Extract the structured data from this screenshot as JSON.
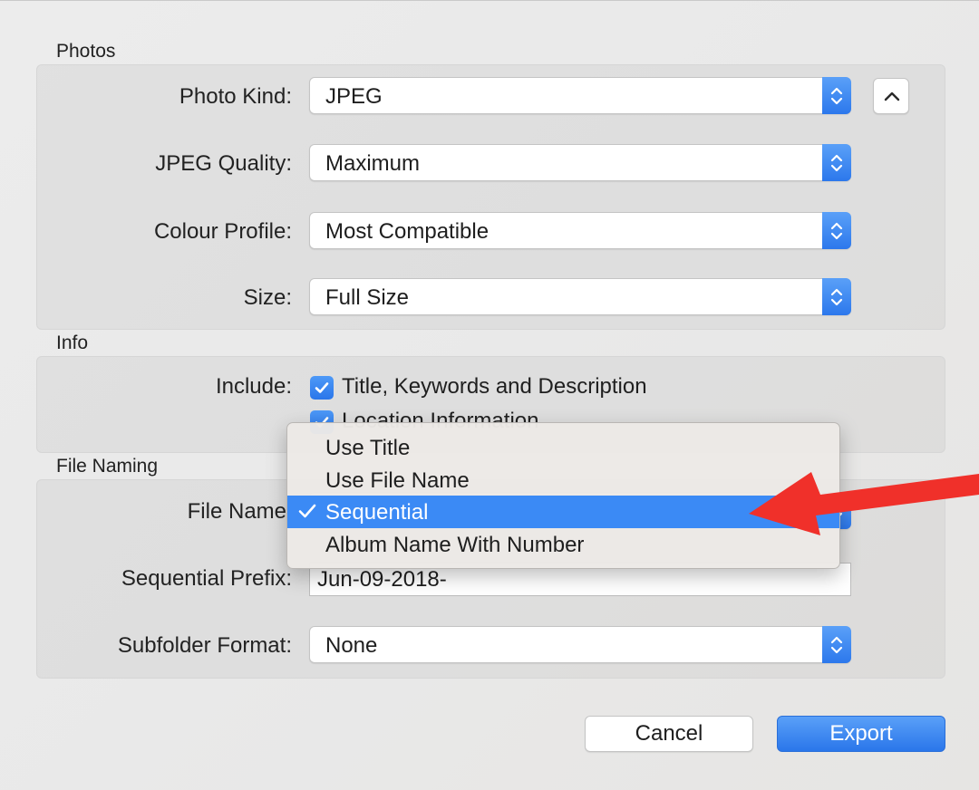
{
  "sections": {
    "photos": "Photos",
    "info": "Info",
    "file_naming": "File Naming"
  },
  "photos": {
    "photo_kind": {
      "label": "Photo Kind:",
      "value": "JPEG"
    },
    "jpeg_quality": {
      "label": "JPEG Quality:",
      "value": "Maximum"
    },
    "colour_profile": {
      "label": "Colour Profile:",
      "value": "Most Compatible"
    },
    "size": {
      "label": "Size:",
      "value": "Full Size"
    }
  },
  "info": {
    "include_label": "Include:",
    "options": [
      {
        "label": "Title, Keywords and Description",
        "checked": true
      },
      {
        "label": "Location Information",
        "checked": true
      }
    ]
  },
  "file_naming": {
    "file_name_label": "File Name",
    "sequential_prefix": {
      "label": "Sequential Prefix:",
      "value": "Jun-09-2018-"
    },
    "subfolder_format": {
      "label": "Subfolder Format:",
      "value": "None"
    }
  },
  "menu": {
    "items": [
      "Use Title",
      "Use File Name",
      "Sequential",
      "Album Name With Number"
    ],
    "selected": "Sequential"
  },
  "buttons": {
    "cancel": "Cancel",
    "export": "Export"
  },
  "colors": {
    "accent": "#3b8af5",
    "annotation_arrow": "#f0302a"
  },
  "icons": {
    "stepper": "up-down-chevron-icon",
    "disclosure": "chevron-up-icon",
    "checkmark": "checkmark-icon",
    "annotation": "red-arrow"
  }
}
